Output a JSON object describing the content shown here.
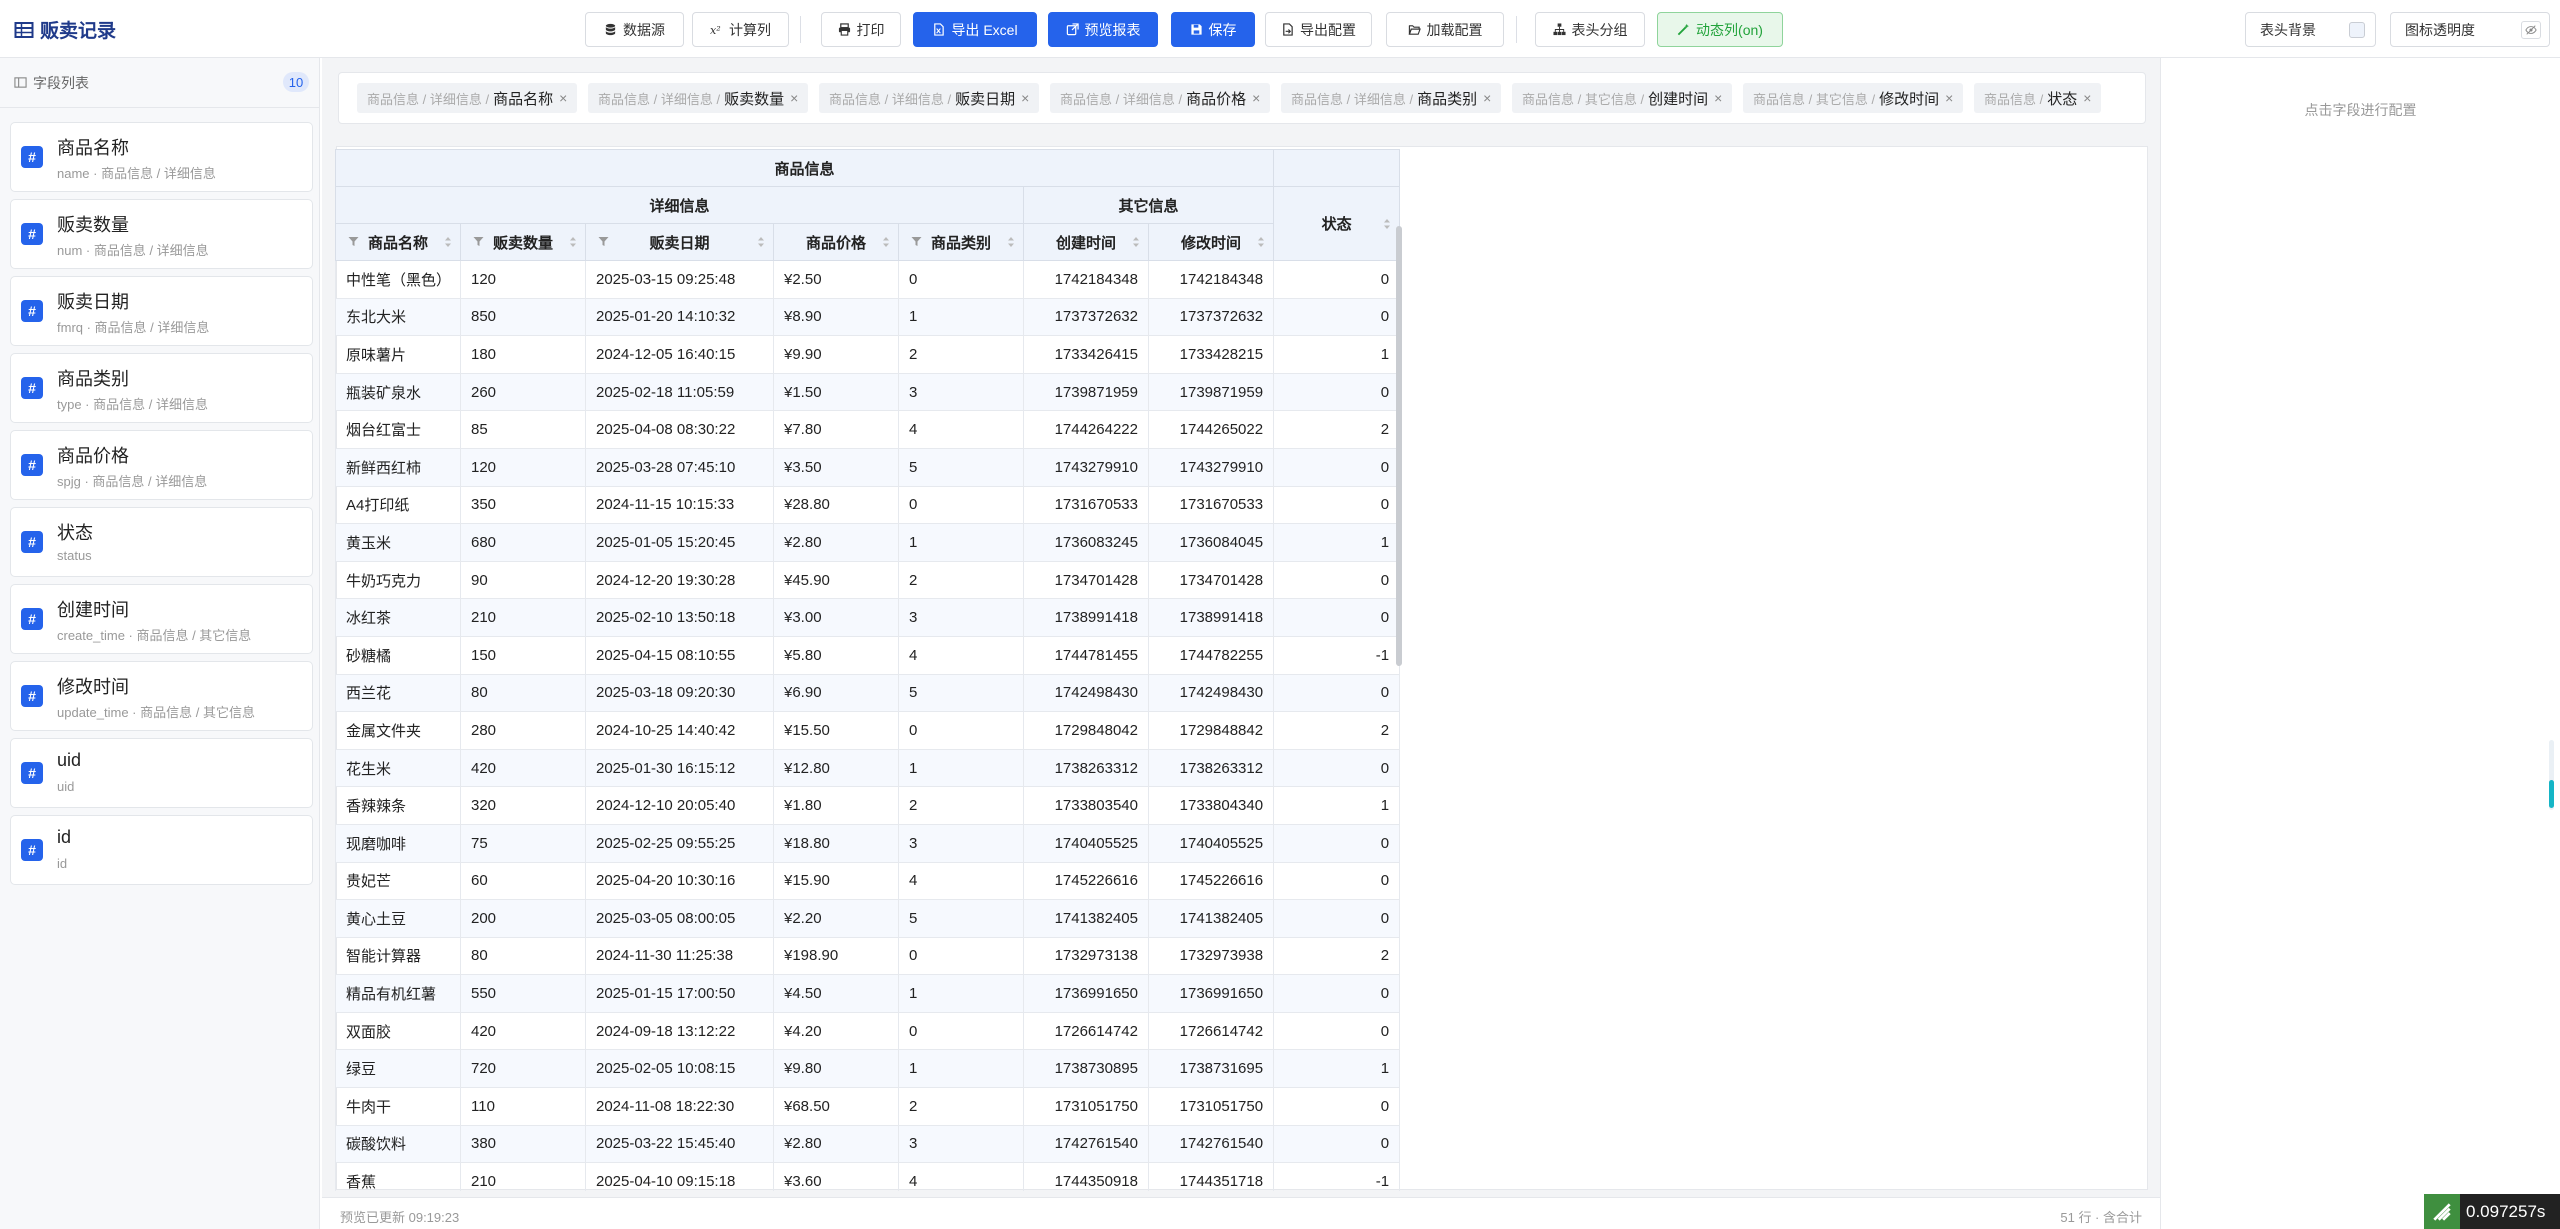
{
  "app": {
    "title": "贩卖记录"
  },
  "toolbar": {
    "datasource": "数据源",
    "calc_col": "计算列",
    "print": "打印",
    "export_excel": "导出 Excel",
    "preview_report": "预览报表",
    "save": "保存",
    "export_config": "导出配置",
    "load_config": "加载配置",
    "header_group": "表头分组",
    "dynamic_col": "动态列(on)",
    "header_bg": "表头背景",
    "icon_opacity": "图标透明度"
  },
  "sidebar": {
    "title": "字段列表",
    "count": "10",
    "fields": [
      {
        "name": "商品名称",
        "sub": "name · 商品信息 / 详细信息"
      },
      {
        "name": "贩卖数量",
        "sub": "num · 商品信息 / 详细信息"
      },
      {
        "name": "贩卖日期",
        "sub": "fmrq · 商品信息 / 详细信息"
      },
      {
        "name": "商品类别",
        "sub": "type · 商品信息 / 详细信息"
      },
      {
        "name": "商品价格",
        "sub": "spjg · 商品信息 / 详细信息"
      },
      {
        "name": "状态",
        "sub": "status"
      },
      {
        "name": "创建时间",
        "sub": "create_time · 商品信息 / 其它信息"
      },
      {
        "name": "修改时间",
        "sub": "update_time · 商品信息 / 其它信息"
      },
      {
        "name": "uid",
        "sub": "uid"
      },
      {
        "name": "id",
        "sub": "id"
      }
    ]
  },
  "chips": [
    {
      "path": "商品信息 / 详细信息 /",
      "label": "商品名称"
    },
    {
      "path": "商品信息 / 详细信息 /",
      "label": "贩卖数量"
    },
    {
      "path": "商品信息 / 详细信息 /",
      "label": "贩卖日期"
    },
    {
      "path": "商品信息 / 详细信息 /",
      "label": "商品价格"
    },
    {
      "path": "商品信息 / 详细信息 /",
      "label": "商品类别"
    },
    {
      "path": "商品信息 / 其它信息 /",
      "label": "创建时间"
    },
    {
      "path": "商品信息 / 其它信息 /",
      "label": "修改时间"
    },
    {
      "path": "商品信息 /",
      "label": "状态"
    }
  ],
  "table": {
    "group_top": "商品信息",
    "group_detail": "详细信息",
    "group_other": "其它信息",
    "columns": [
      "商品名称",
      "贩卖数量",
      "贩卖日期",
      "商品价格",
      "商品类别",
      "创建时间",
      "修改时间",
      "状态"
    ],
    "rows": [
      [
        "中性笔（黑色）",
        "120",
        "2025-03-15 09:25:48",
        "¥2.50",
        "0",
        "1742184348",
        "1742184348",
        "0"
      ],
      [
        "东北大米",
        "850",
        "2025-01-20 14:10:32",
        "¥8.90",
        "1",
        "1737372632",
        "1737372632",
        "0"
      ],
      [
        "原味薯片",
        "180",
        "2024-12-05 16:40:15",
        "¥9.90",
        "2",
        "1733426415",
        "1733428215",
        "1"
      ],
      [
        "瓶装矿泉水",
        "260",
        "2025-02-18 11:05:59",
        "¥1.50",
        "3",
        "1739871959",
        "1739871959",
        "0"
      ],
      [
        "烟台红富士",
        "85",
        "2025-04-08 08:30:22",
        "¥7.80",
        "4",
        "1744264222",
        "1744265022",
        "2"
      ],
      [
        "新鲜西红柿",
        "120",
        "2025-03-28 07:45:10",
        "¥3.50",
        "5",
        "1743279910",
        "1743279910",
        "0"
      ],
      [
        "A4打印纸",
        "350",
        "2024-11-15 10:15:33",
        "¥28.80",
        "0",
        "1731670533",
        "1731670533",
        "0"
      ],
      [
        "黄玉米",
        "680",
        "2025-01-05 15:20:45",
        "¥2.80",
        "1",
        "1736083245",
        "1736084045",
        "1"
      ],
      [
        "牛奶巧克力",
        "90",
        "2024-12-20 19:30:28",
        "¥45.90",
        "2",
        "1734701428",
        "1734701428",
        "0"
      ],
      [
        "冰红茶",
        "210",
        "2025-02-10 13:50:18",
        "¥3.00",
        "3",
        "1738991418",
        "1738991418",
        "0"
      ],
      [
        "砂糖橘",
        "150",
        "2025-04-15 08:10:55",
        "¥5.80",
        "4",
        "1744781455",
        "1744782255",
        "-1"
      ],
      [
        "西兰花",
        "80",
        "2025-03-18 09:20:30",
        "¥6.90",
        "5",
        "1742498430",
        "1742498430",
        "0"
      ],
      [
        "金属文件夹",
        "280",
        "2024-10-25 14:40:42",
        "¥15.50",
        "0",
        "1729848042",
        "1729848842",
        "2"
      ],
      [
        "花生米",
        "420",
        "2025-01-30 16:15:12",
        "¥12.80",
        "1",
        "1738263312",
        "1738263312",
        "0"
      ],
      [
        "香辣辣条",
        "320",
        "2024-12-10 20:05:40",
        "¥1.80",
        "2",
        "1733803540",
        "1733804340",
        "1"
      ],
      [
        "现磨咖啡",
        "75",
        "2025-02-25 09:55:25",
        "¥18.80",
        "3",
        "1740405525",
        "1740405525",
        "0"
      ],
      [
        "贵妃芒",
        "60",
        "2025-04-20 10:30:16",
        "¥15.90",
        "4",
        "1745226616",
        "1745226616",
        "0"
      ],
      [
        "黄心土豆",
        "200",
        "2025-03-05 08:00:05",
        "¥2.20",
        "5",
        "1741382405",
        "1741382405",
        "0"
      ],
      [
        "智能计算器",
        "80",
        "2024-11-30 11:25:38",
        "¥198.90",
        "0",
        "1732973138",
        "1732973938",
        "2"
      ],
      [
        "精品有机红薯",
        "550",
        "2025-01-15 17:00:50",
        "¥4.50",
        "1",
        "1736991650",
        "1736991650",
        "0"
      ],
      [
        "双面胶",
        "420",
        "2024-09-18 13:12:22",
        "¥4.20",
        "0",
        "1726614742",
        "1726614742",
        "0"
      ],
      [
        "绿豆",
        "720",
        "2025-02-05 10:08:15",
        "¥9.80",
        "1",
        "1738730895",
        "1738731695",
        "1"
      ],
      [
        "牛肉干",
        "110",
        "2024-11-08 18:22:30",
        "¥68.50",
        "2",
        "1731051750",
        "1731051750",
        "0"
      ],
      [
        "碳酸饮料",
        "380",
        "2025-03-22 15:45:40",
        "¥2.80",
        "3",
        "1742761540",
        "1742761540",
        "0"
      ],
      [
        "香蕉",
        "210",
        "2025-04-10 09:15:18",
        "¥3.60",
        "4",
        "1744350918",
        "1744351718",
        "-1"
      ]
    ]
  },
  "status": {
    "updated": "预览已更新 09:19:23",
    "summary": "51 行 · 含合计"
  },
  "right_panel": {
    "hint": "点击字段进行配置"
  },
  "timer": {
    "value": "0.097257s"
  },
  "colors": {
    "primary": "#2563eb",
    "header_bg": "#eef3fb",
    "green": "#22a33b"
  }
}
